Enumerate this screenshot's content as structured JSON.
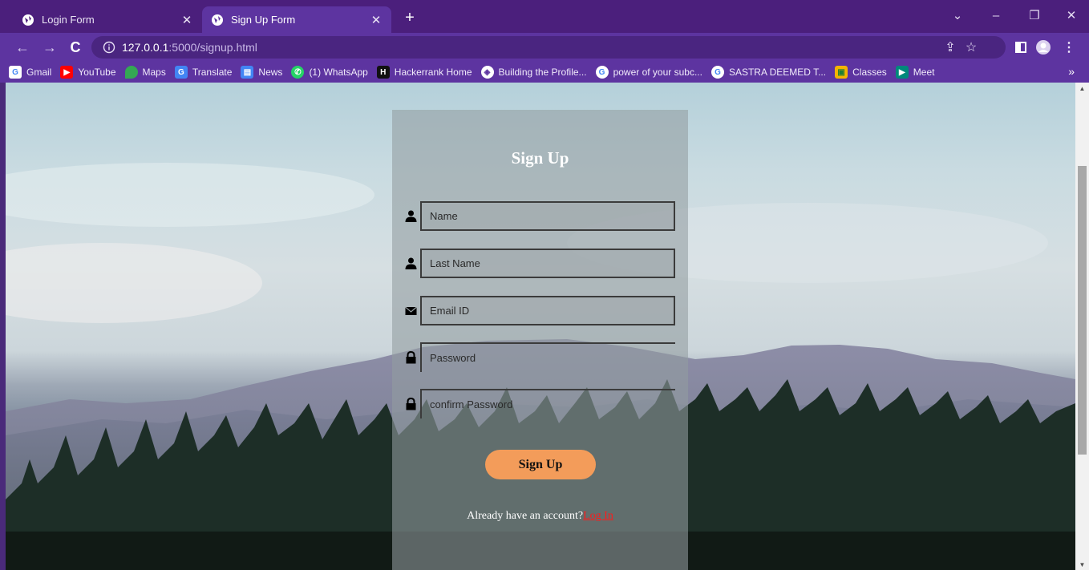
{
  "browser": {
    "tabs": [
      {
        "title": "Login Form",
        "icon": "globe-icon",
        "active": false
      },
      {
        "title": "Sign Up Form",
        "icon": "globe-icon",
        "active": true
      }
    ],
    "url_host": "127.0.0.1",
    "url_rest": ":5000/signup.html",
    "bookmarks": [
      {
        "label": "Gmail",
        "icon": "google-icon",
        "color": "#ffffff"
      },
      {
        "label": "YouTube",
        "icon": "youtube-icon",
        "color": "#ff0000"
      },
      {
        "label": "Maps",
        "icon": "maps-icon",
        "color": "#34a853"
      },
      {
        "label": "Translate",
        "icon": "translate-icon",
        "color": "#4285f4"
      },
      {
        "label": "News",
        "icon": "news-icon",
        "color": "#4285f4"
      },
      {
        "label": "(1) WhatsApp",
        "icon": "whatsapp-icon",
        "color": "#25d366"
      },
      {
        "label": "Hackerrank Home",
        "icon": "hackerrank-icon",
        "color": "#111111"
      },
      {
        "label": "Building the Profile...",
        "icon": "globe-icon",
        "color": "#ffffff"
      },
      {
        "label": "power of your subc...",
        "icon": "google-icon",
        "color": "#ffffff"
      },
      {
        "label": "SASTRA DEEMED T...",
        "icon": "google-icon",
        "color": "#ffffff"
      },
      {
        "label": "Classes",
        "icon": "classroom-icon",
        "color": "#f4b400"
      },
      {
        "label": "Meet",
        "icon": "meet-icon",
        "color": "#00897b"
      }
    ],
    "bookmarks_more": "»"
  },
  "form": {
    "title": "Sign Up",
    "fields": [
      {
        "name": "name-field",
        "placeholder": "Name",
        "icon": "user-icon"
      },
      {
        "name": "last-name-field",
        "placeholder": "Last Name",
        "icon": "user-icon"
      },
      {
        "name": "email-field",
        "placeholder": "Email ID",
        "icon": "envelope-icon"
      },
      {
        "name": "password-field",
        "placeholder": "Password",
        "icon": "lock-icon"
      },
      {
        "name": "confirm-password-field",
        "placeholder": "confirm Password",
        "icon": "lock-icon"
      }
    ],
    "submit_label": "Sign Up",
    "signin_text": "Already have an account?",
    "signin_link": "Log In"
  },
  "colors": {
    "accent_button": "#f39c5a",
    "link": "#ff1a1a",
    "chrome": "#5d34a0"
  }
}
